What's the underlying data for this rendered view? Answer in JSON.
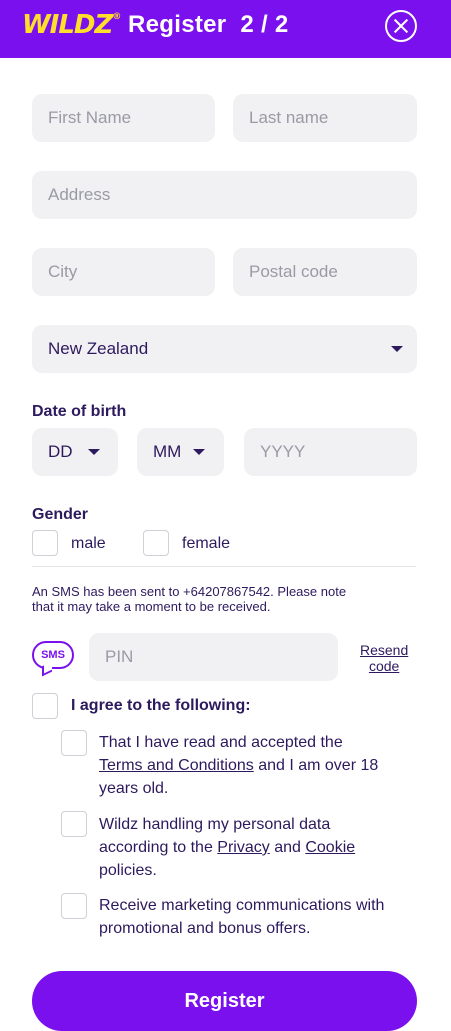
{
  "header": {
    "logo": "WILDZ",
    "logo_mark": "®",
    "title": "Register  2 / 2",
    "close_icon": "close-circle-icon"
  },
  "colors": {
    "brand": "#7a10ee",
    "logo": "#ffdf2a",
    "text": "#2d1a5e",
    "field_bg": "#f1f1f3"
  },
  "form": {
    "first_name_placeholder": "First Name",
    "last_name_placeholder": "Last name",
    "address_placeholder": "Address",
    "city_placeholder": "City",
    "postal_placeholder": "Postal code",
    "country_value": "New Zealand",
    "dob_label": "Date of birth",
    "dob_day": "DD",
    "dob_month": "MM",
    "dob_year_placeholder": "YYYY",
    "gender_label": "Gender",
    "gender_male": "male",
    "gender_female": "female"
  },
  "sms": {
    "notice_line1": "An SMS has been sent to +64207867542. Please note",
    "notice_line2": "that it may take a moment to be received.",
    "badge": "SMS",
    "pin_placeholder": "PIN",
    "resend_line1": "Resend",
    "resend_line2": "code"
  },
  "agreement": {
    "all_label": "I agree to the following:",
    "terms_pre": "That I have read and accepted the",
    "terms_link": "Terms and Conditions",
    "terms_post": " and I am over 18",
    "terms_post2": "years old.",
    "privacy_pre1": "Wildz handling my personal data",
    "privacy_pre2": "according to the ",
    "privacy_link": "Privacy",
    "privacy_and": " and ",
    "cookie_link": "Cookie",
    "privacy_post": "policies.",
    "marketing_line1": "Receive marketing communications with",
    "marketing_line2": "promotional and bonus offers."
  },
  "register_button": "Register"
}
